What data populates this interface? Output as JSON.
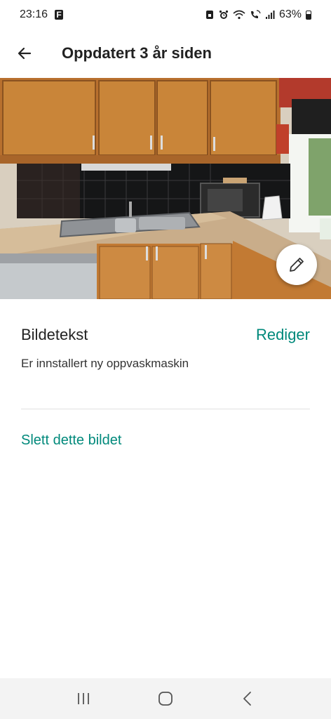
{
  "status_bar": {
    "time": "23:16",
    "notification_icon": "f-app-icon",
    "battery": "63%",
    "battery_level": 0.63,
    "icons": [
      "sim-icon",
      "alarm-icon",
      "wifi-icon",
      "wifi-calling-icon",
      "signal-icon",
      "battery-icon"
    ]
  },
  "app_bar": {
    "title": "Oppdatert 3 år siden",
    "back_icon": "arrow-back-icon"
  },
  "photo": {
    "subject": "kitchen-photo",
    "edit_icon": "pencil-icon"
  },
  "caption": {
    "title": "Bildetekst",
    "edit_label": "Rediger",
    "text": "Er innstallert ny oppvaskmaskin"
  },
  "actions": {
    "delete_label": "Slett dette bildet"
  },
  "nav_bar": {
    "icons": [
      "recent-apps-icon",
      "home-icon",
      "back-icon"
    ]
  },
  "colors": {
    "accent": "#00897b",
    "title_text": "#222222",
    "nav_background": "#f3f3f3"
  }
}
